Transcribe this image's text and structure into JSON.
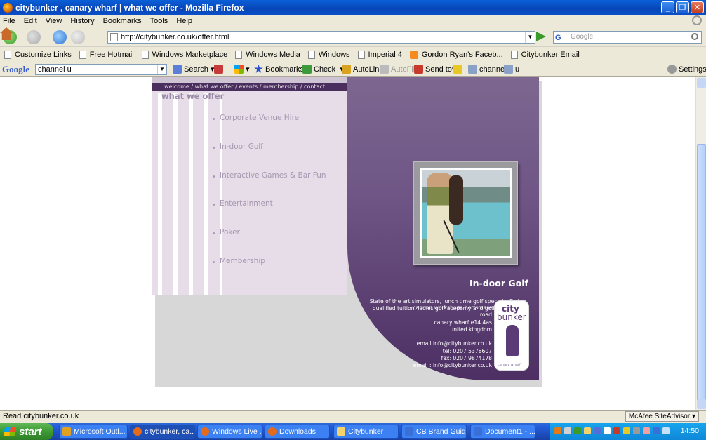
{
  "window": {
    "title": "citybunker , canary wharf  |  what we offer - Mozilla Firefox",
    "min": "_",
    "max": "❐",
    "close": "✕"
  },
  "menu": [
    "File",
    "Edit",
    "View",
    "History",
    "Bookmarks",
    "Tools",
    "Help"
  ],
  "nav": {
    "url": "http://citybunker.co.uk/offer.html",
    "search_placeholder": "Google",
    "search_engine": "G"
  },
  "bookmarks": [
    {
      "label": "Customize Links",
      "icon": "page-icon"
    },
    {
      "label": "Free Hotmail",
      "icon": "page-icon"
    },
    {
      "label": "Windows Marketplace",
      "icon": "page-icon"
    },
    {
      "label": "Windows Media",
      "icon": "page-icon"
    },
    {
      "label": "Windows",
      "icon": "page-icon"
    },
    {
      "label": "Imperial 4",
      "icon": "page-icon"
    },
    {
      "label": "Gordon Ryan's Faceb...",
      "icon": "rss-icon"
    },
    {
      "label": "Citybunker Email",
      "icon": "page-icon"
    }
  ],
  "google_toolbar": {
    "logo": "Google",
    "query": "channel u",
    "search": "Search",
    "bookmarks": "Bookmarks",
    "check": "Check",
    "autolink": "AutoLink",
    "autofill": "AutoFill",
    "sendto": "Send to",
    "channel": "channel",
    "u": "u",
    "settings": "Settings"
  },
  "site": {
    "nav": "welcome / what we offer / events / membership / contact",
    "section_title": "what we offer",
    "offers": [
      "Corporate Venue Hire",
      "In-door Golf",
      "Interactive Games & Bar Fun",
      "Entertainment",
      "Poker",
      "Membership"
    ],
    "feature_title": "In-door Golf",
    "feature_desc": "State of the art simulators, lunch time golf specials, Ealing qualified tuition, ladies golf academy and golf beginners",
    "address": [
      "cannon workshops hertsmere road",
      "canary wharf e14 4as",
      "united kingdom",
      "",
      "email info@citybunker.co.uk",
      "tel: 0207 5378607",
      "fax: 0207 9874178",
      "email : info@citybunker.co.uk"
    ],
    "logo_line1": "city",
    "logo_line2": "bunker",
    "logo_tag": "canary wharf"
  },
  "status": {
    "text": "Read citybunker.co.uk",
    "mcafee": "McAfee SiteAdvisor"
  },
  "taskbar": {
    "start": "start",
    "tasks": [
      {
        "label": "Microsoft Outl...",
        "color": "#e0a020"
      },
      {
        "label": "citybunker, ca...",
        "color": "#e56a1a"
      },
      {
        "label": "Windows Live ...",
        "color": "#e56a1a"
      },
      {
        "label": "Downloads",
        "color": "#e56a1a"
      },
      {
        "label": "Citybunker",
        "color": "#f5d36b"
      },
      {
        "label": "CB Brand Guid...",
        "color": "#3a6fd8"
      },
      {
        "label": "Document1 - ...",
        "color": "#3a6fd8"
      }
    ],
    "time": "14:50"
  }
}
